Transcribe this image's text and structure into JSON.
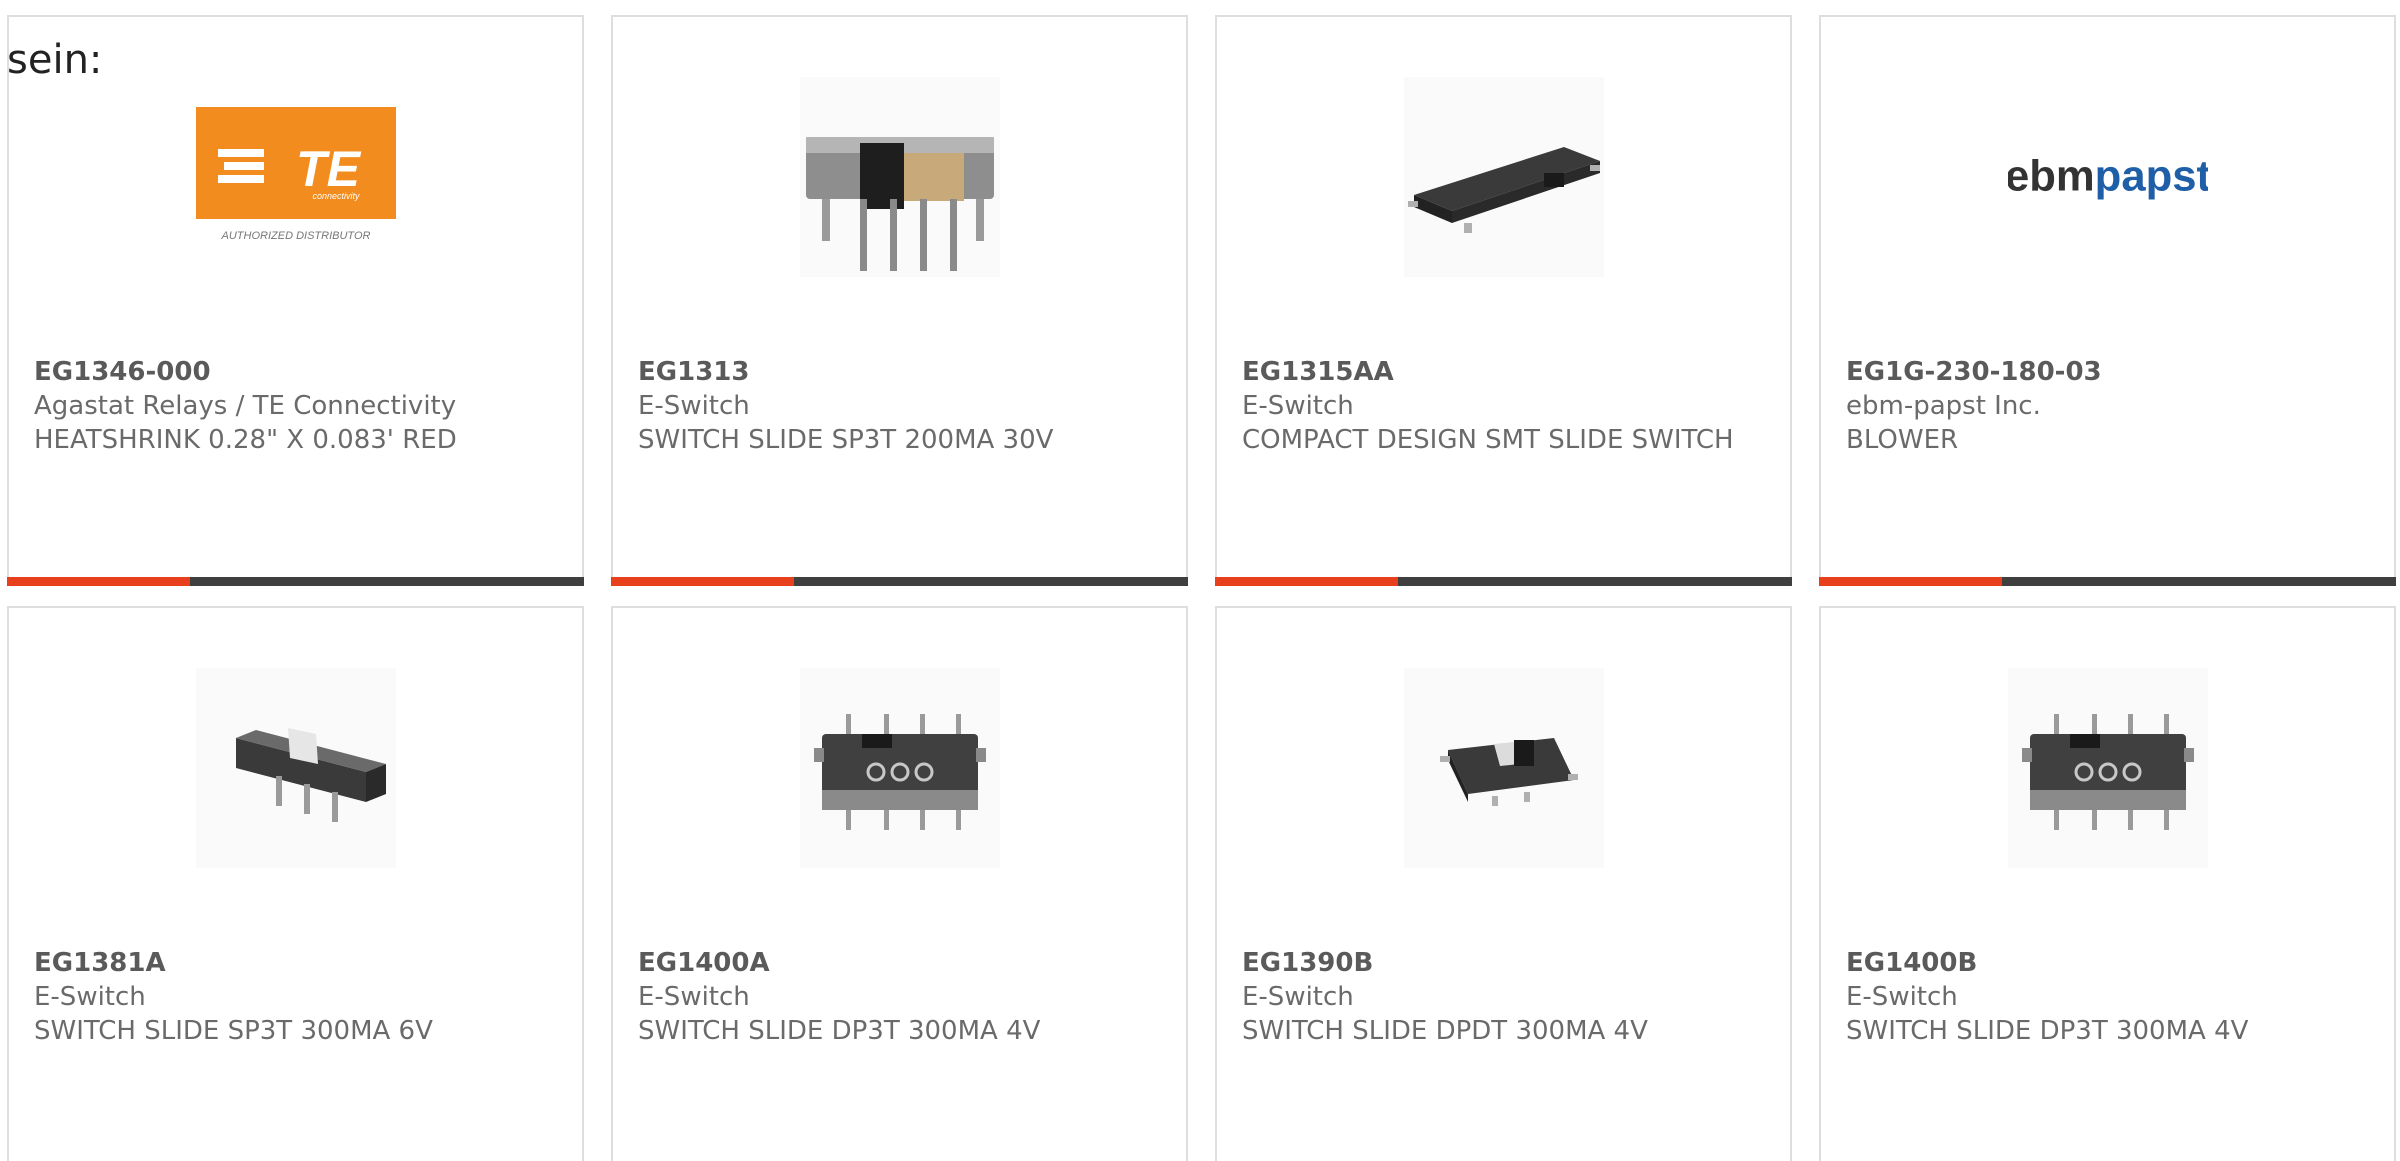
{
  "intro_text": "sein:",
  "colors": {
    "accent": "#e8401c",
    "bar": "#3f3f3f",
    "border": "#dedede",
    "text": "#6a6a6a",
    "te_logo": "#f28c1e",
    "ebm_dark": "#333333",
    "papst_blue": "#1e5fa8"
  },
  "te_logo": {
    "wordmark": "TE",
    "sub": "connectivity",
    "caption": "AUTHORIZED DISTRIBUTOR"
  },
  "ebm_logo": {
    "part1": "ebm",
    "part2": "papst"
  },
  "products": [
    {
      "part": "EG1346-000",
      "maker": "Agastat Relays / TE Connectivity",
      "desc": "HEATSHRINK 0.28\" X 0.083' RED",
      "image": "te-connectivity-logo"
    },
    {
      "part": "EG1313",
      "maker": "E-Switch",
      "desc": "SWITCH SLIDE SP3T 200MA 30V",
      "image": "slide-switch-tall-icon"
    },
    {
      "part": "EG1315AA",
      "maker": "E-Switch",
      "desc": "COMPACT DESIGN SMT SLIDE SWITCH",
      "image": "smt-slide-switch-icon"
    },
    {
      "part": "EG1G-230-180-03",
      "maker": "ebm-papst Inc.",
      "desc": "BLOWER",
      "image": "ebm-papst-logo"
    },
    {
      "part": "EG1381A",
      "maker": "E-Switch",
      "desc": "SWITCH SLIDE SP3T 300MA 6V",
      "image": "mini-slide-switch-icon"
    },
    {
      "part": "EG1400A",
      "maker": "E-Switch",
      "desc": "SWITCH SLIDE DP3T 300MA 4V",
      "image": "dp3t-slide-switch-icon"
    },
    {
      "part": "EG1390B",
      "maker": "E-Switch",
      "desc": "SWITCH SLIDE DPDT 300MA 4V",
      "image": "dpdt-slide-switch-icon"
    },
    {
      "part": "EG1400B",
      "maker": "E-Switch",
      "desc": "SWITCH SLIDE DP3T 300MA 4V",
      "image": "dp3t-slide-switch-icon"
    }
  ]
}
